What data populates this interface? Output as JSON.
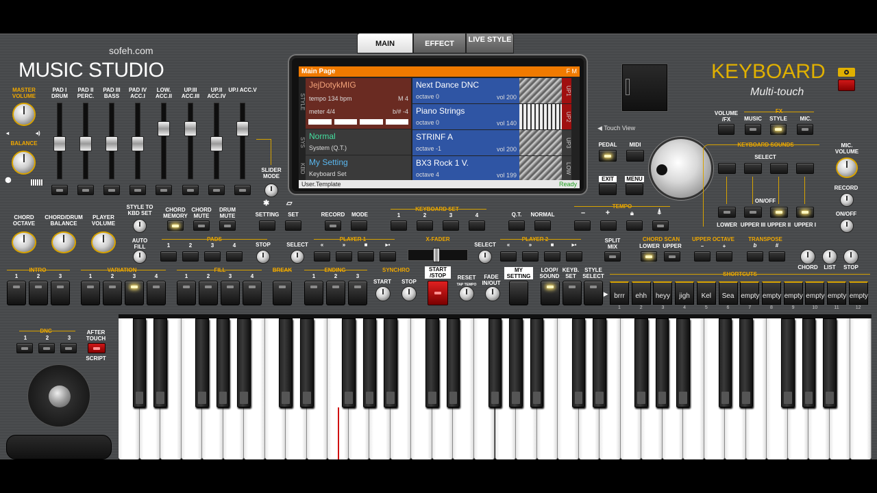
{
  "brand": {
    "site": "sofeh.com",
    "title": "MUSIC STUDIO",
    "product": "KEYBOARD",
    "subtitle": "Multi-touch"
  },
  "tabs": [
    {
      "label": "MAIN",
      "active": true
    },
    {
      "label": "EFFECT",
      "active": false
    },
    {
      "label": "LIVE STYLE",
      "active": false
    }
  ],
  "colors": {
    "accent": "#d8a300",
    "screen_header": "#f07a00",
    "style_cell": "#6a2b22",
    "slot_blue": "#2f55a4",
    "led_on": "#ffe46b",
    "red_button": "#c41818"
  },
  "left": {
    "master_volume": "MASTER VOLUME",
    "balance": "BALANCE",
    "sliders": [
      "PAD I DRUM",
      "PAD II PERC.",
      "PAD III BASS",
      "PAD IV ACC.I",
      "LOW. ACC.II",
      "UP.III ACC.III",
      "UP.II ACC.IV",
      "UP.I ACC.V"
    ],
    "slider_levels": [
      0.72,
      0.72,
      0.72,
      0.72,
      0.92,
      0.92,
      0.72,
      0.92
    ],
    "slider_mode": "SLIDER MODE",
    "chord_octave": "CHORD OCTAVE",
    "chord_drum_balance": "CHORD/DRUM BALANCE",
    "player_volume": "PLAYER VOLUME"
  },
  "screen": {
    "header": "Main Page",
    "header_right": "F M",
    "style_name": "JejDotykMIG",
    "tempo": "tempo 134 bpm",
    "measure": "M 4",
    "meter": "meter 4/4",
    "key": "b/# -4",
    "sys_name": "Normal",
    "sys_sub": "System (Q.T.)",
    "kbd_name": "My Setting",
    "kbd_sub": "Keyboard Set",
    "left_tags": [
      "STYLE",
      "SYS",
      "KBD"
    ],
    "slots": [
      {
        "name": "Next Dance DNC",
        "octave": "octave 0",
        "vol": "vol 200",
        "tag": "UP1"
      },
      {
        "name": "Piano Strings",
        "octave": "octave 0",
        "vol": "vol 140",
        "tag": "UP2"
      },
      {
        "name": "STRINF A",
        "octave": "octave -1",
        "vol": "vol 200",
        "tag": "UP3"
      },
      {
        "name": "BX3 Rock 1 V.",
        "octave": "octave 4",
        "vol": "vol 199",
        "tag": "LOW"
      }
    ],
    "footer": "User.Template",
    "status": "Ready"
  },
  "right": {
    "touch_view": "Touch View",
    "pedal": "PEDAL",
    "midi": "MIDI",
    "exit": "EXIT",
    "menu": "MENU",
    "volume_fx": "VOLUME /FX",
    "fx": "FX",
    "music": "MUSIC",
    "style": "STYLE",
    "mic": "MIC.",
    "keyboard_sounds": "KEYBOARD SOUNDS",
    "select": "SELECT",
    "onoff": "ON/OFF",
    "sounds": [
      "LOWER",
      "UPPER III",
      "UPPER II",
      "UPPER I"
    ],
    "mic_volume": "MIC. VOLUME",
    "record": "RECORD",
    "onoff2": "ON/OFF"
  },
  "row2": {
    "style_to_kbd": "STYLE TO KBD SET",
    "chord_memory": "CHORD MEMORY",
    "chord_mute": "CHORD MUTE",
    "drum_mute": "DRUM MUTE",
    "setting": "SETTING",
    "set": "SET",
    "record": "RECORD",
    "mode": "MODE",
    "keyboard_set": "KEYBOARD SET",
    "kbd_set_nums": [
      "1",
      "2",
      "3",
      "4"
    ],
    "qt": "Q.T.",
    "normal": "NORMAL",
    "tempo": "TEMPO",
    "minus": "–",
    "plus": "+"
  },
  "row3": {
    "auto_fill": "AUTO FILL",
    "pads": "PADS",
    "pad_nums": [
      "1",
      "2",
      "3",
      "4"
    ],
    "stop": "STOP",
    "select": "SELECT",
    "player1": "PLAYER 1",
    "xfader": "X-FADER",
    "player2": "PLAYER 2",
    "select2": "SELECT",
    "split_mix": "SPLIT MIX",
    "chord_scan": "CHORD SCAN",
    "lower": "LOWER",
    "upper": "UPPER",
    "upper_octave": "UPPER OCTAVE",
    "transpose": "TRANSPOSE",
    "flat": "b",
    "sharp": "#",
    "chord": "CHORD",
    "list": "LIST",
    "stop2": "STOP"
  },
  "row4": {
    "intro": "INTRO",
    "variation": "VARIATION",
    "fill": "FILL",
    "break": "BREAK",
    "ending": "ENDING",
    "synchro": "SYNCHRO",
    "start": "START",
    "stop": "STOP",
    "start_stop": "START /STOP",
    "reset": "RESET",
    "tap_tempo": "TAP TEMPO",
    "fade": "FADE IN/OUT",
    "my_setting": "MY SETTING",
    "loop_sound": "LOOP/ SOUND",
    "keyb_set": "KEYB. SET",
    "style_select": "STYLE SELECT",
    "shortcuts": "SHORTCUTS"
  },
  "shortcuts": [
    {
      "label": "brrr",
      "num": "1"
    },
    {
      "label": "ehh",
      "num": "2"
    },
    {
      "label": "heyy",
      "num": "3"
    },
    {
      "label": "jigh",
      "num": "4"
    },
    {
      "label": "Kel",
      "num": "5"
    },
    {
      "label": "Sea",
      "num": "6"
    },
    {
      "label": "empty",
      "num": "7"
    },
    {
      "label": "empty",
      "num": "8"
    },
    {
      "label": "empty",
      "num": "9"
    },
    {
      "label": "empty",
      "num": "10"
    },
    {
      "label": "empty",
      "num": "11"
    },
    {
      "label": "empty",
      "num": "12"
    }
  ],
  "dnc": {
    "label": "DNC",
    "nums": [
      "1",
      "2",
      "3"
    ],
    "after_touch": "AFTER TOUCH",
    "script": "SCRIPT"
  },
  "num_labels": {
    "n1": "1",
    "n2": "2",
    "n3": "3",
    "n4": "4"
  }
}
